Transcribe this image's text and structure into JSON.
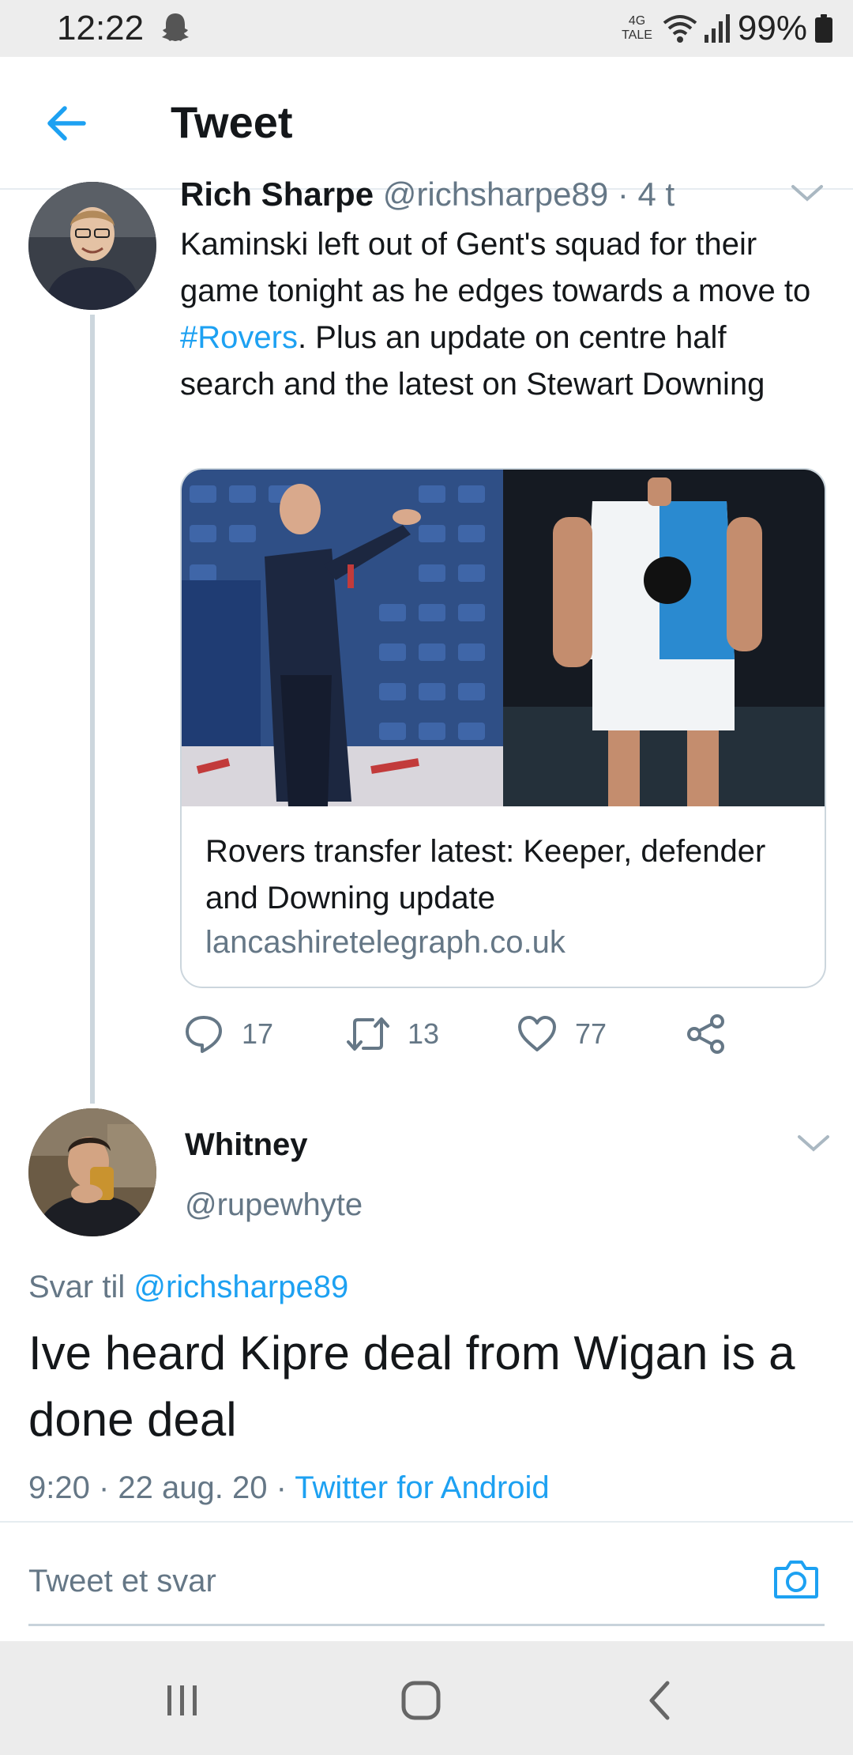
{
  "status_bar": {
    "time": "12:22",
    "network_type": "4G",
    "network_sub": "TALE",
    "battery": "99%",
    "icons": [
      "ghost-icon",
      "wifi-icon",
      "signal-icon",
      "battery-icon"
    ]
  },
  "header": {
    "title": "Tweet",
    "back_icon": "arrow-left-icon",
    "accent_color": "#1da1f2"
  },
  "parent_tweet": {
    "name": "Rich Sharpe",
    "handle": "@richsharpe89",
    "time_sep": " · ",
    "time_ago": "4 t",
    "text_before_hashtag": "Kaminski left out of Gent's squad for their game tonight as he edges towards a move to ",
    "hashtag": "#Rovers",
    "text_after_hashtag": ". Plus an update on centre half search and the latest on Stewart Downing",
    "card": {
      "title": "Rovers transfer latest: Keeper, defender and Downing update",
      "domain": "lancashiretelegraph.co.uk"
    },
    "actions": {
      "replies": "17",
      "retweets": "13",
      "likes": "77"
    }
  },
  "reply_tweet": {
    "name": "Whitney",
    "handle": "@rupewhyte",
    "reply_to_label": "Svar til ",
    "reply_to_handle": "@richsharpe89",
    "text": "Ive heard Kipre deal from Wigan is a done deal",
    "timestamp": "9:20 · 22 aug. 20 · ",
    "source": "Twitter for Android"
  },
  "composer": {
    "placeholder": "Tweet et svar",
    "camera_icon": "camera-icon"
  },
  "nav_bar": {
    "icons": [
      "recents-icon",
      "home-icon",
      "back-icon"
    ]
  }
}
